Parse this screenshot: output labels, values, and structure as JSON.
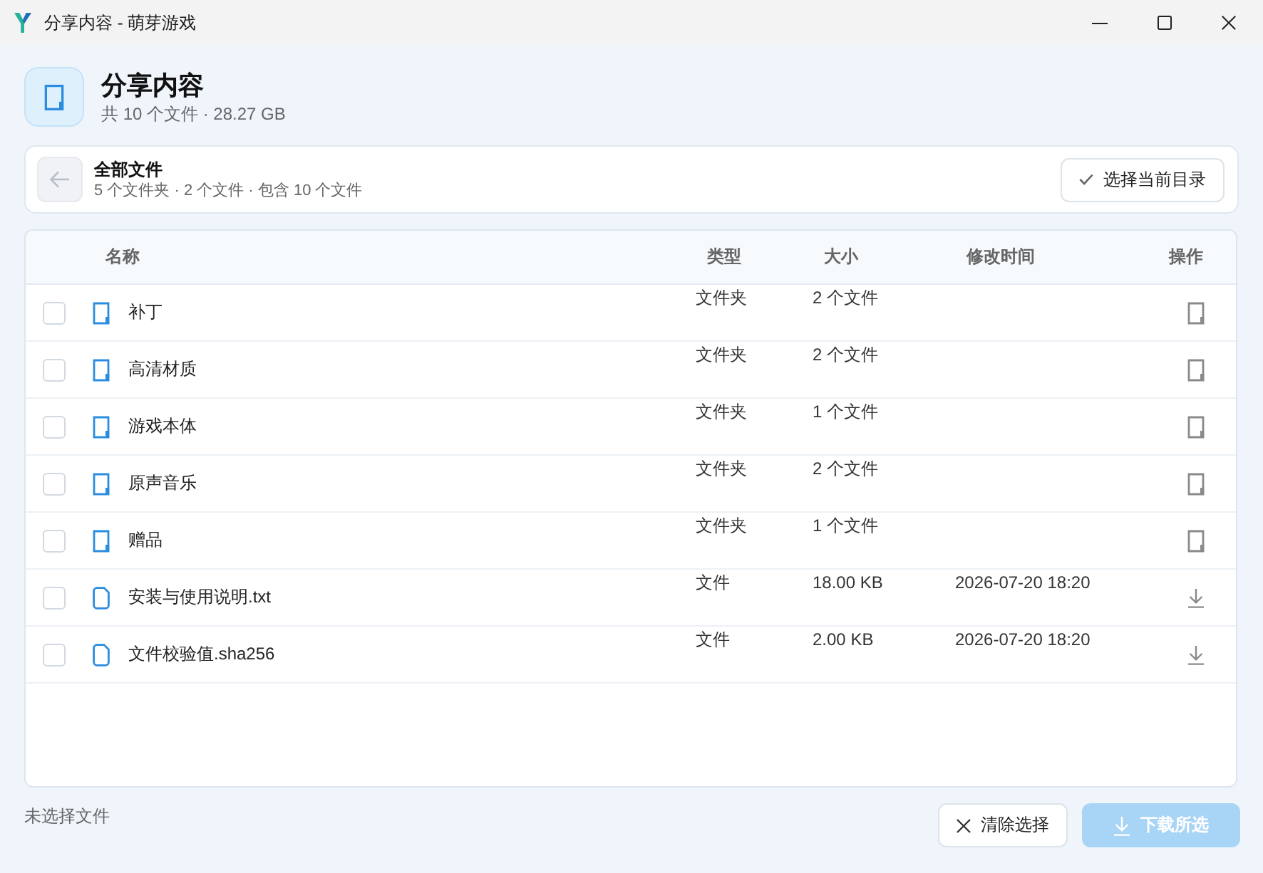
{
  "window": {
    "title": "分享内容 - 萌芽游戏"
  },
  "header": {
    "title": "分享内容",
    "summary": "共 10 个文件 · 28.27 GB"
  },
  "breadcrumb": {
    "back_button": {
      "disabled": true
    },
    "title": "全部文件",
    "summary": "5 个文件夹 · 2 个文件 · 包含 10 个文件",
    "select_button": "选择当前目录"
  },
  "table": {
    "columns": [
      "名称",
      "类型",
      "大小",
      "修改时间",
      "操作"
    ],
    "rows": [
      {
        "kind": "folder",
        "checked": false,
        "name": "补丁",
        "type": "文件夹",
        "size": "2 个文件"
      },
      {
        "kind": "folder",
        "checked": false,
        "name": "高清材质",
        "type": "文件夹",
        "size": "2 个文件"
      },
      {
        "kind": "folder",
        "checked": false,
        "name": "游戏本体",
        "type": "文件夹",
        "size": "1 个文件"
      },
      {
        "kind": "folder",
        "checked": false,
        "name": "原声音乐",
        "type": "文件夹",
        "size": "2 个文件"
      },
      {
        "kind": "folder",
        "checked": false,
        "name": "赠品",
        "type": "文件夹",
        "size": "1 个文件"
      },
      {
        "kind": "file",
        "checked": false,
        "name": "安装与使用说明.txt",
        "type": "文件",
        "size": "18.00 KB",
        "modified": "2026-07-20 18:20"
      },
      {
        "kind": "file",
        "checked": false,
        "name": "文件校验值.sha256",
        "type": "文件",
        "size": "2.00 KB",
        "modified": "2026-07-20 18:20"
      }
    ]
  },
  "footer": {
    "status": "未选择文件",
    "buttons": [
      {
        "kind": "clear",
        "label": "清除选择",
        "disabled": false
      },
      {
        "kind": "download",
        "label": "下载所选",
        "disabled": true
      }
    ]
  }
}
